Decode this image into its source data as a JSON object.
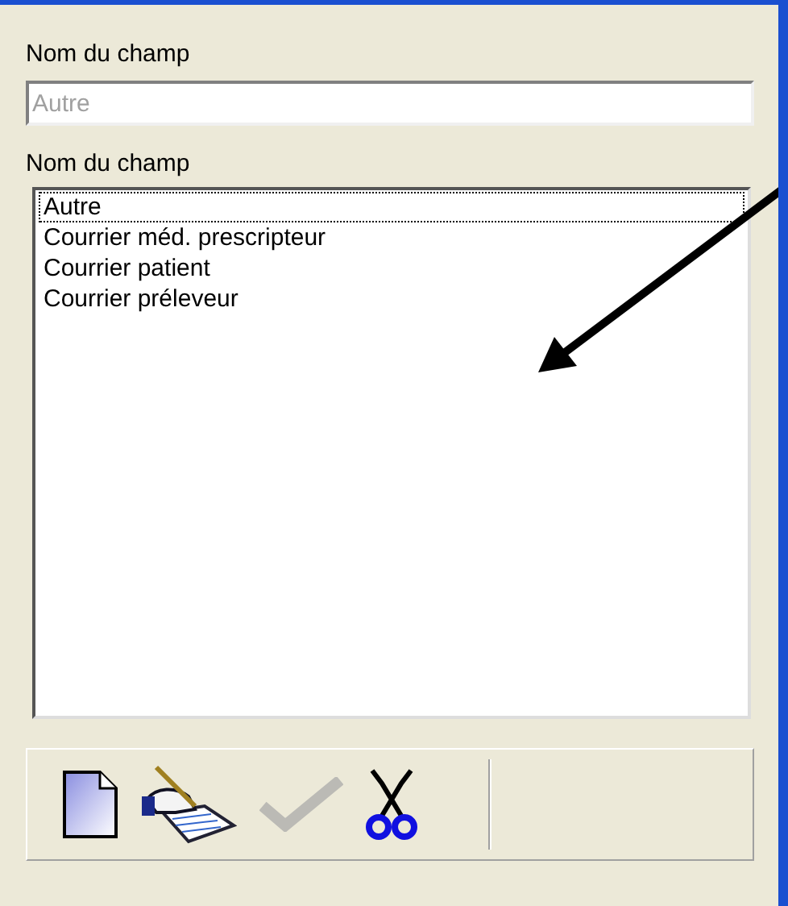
{
  "name_field": {
    "label": "Nom du champ",
    "value": "Autre",
    "disabled": true
  },
  "name_list": {
    "label": "Nom du champ",
    "items": [
      {
        "text": "Autre",
        "focused": true
      },
      {
        "text": "Courrier méd. prescripteur",
        "focused": false
      },
      {
        "text": "Courrier patient",
        "focused": false
      },
      {
        "text": "Courrier préleveur",
        "focused": false
      }
    ]
  },
  "toolbar": [
    {
      "kind": "new",
      "disabled": false
    },
    {
      "kind": "edit",
      "disabled": false
    },
    {
      "kind": "validate",
      "disabled": true
    },
    {
      "kind": "cut",
      "disabled": false
    }
  ]
}
